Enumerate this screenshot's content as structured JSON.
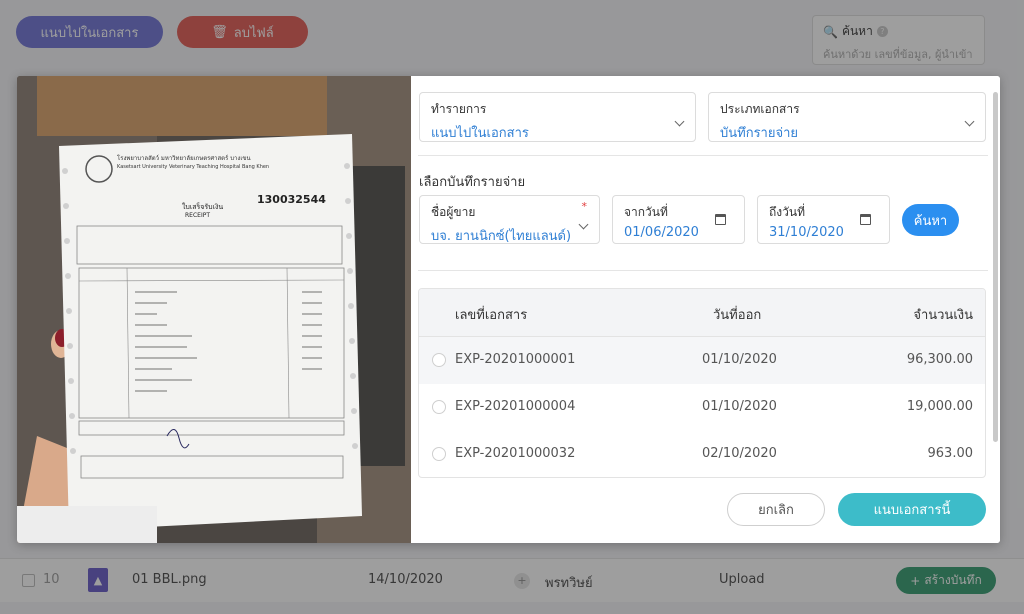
{
  "background": {
    "attach_button": "แนบไปในเอกสาร",
    "delete_button": "ลบไฟล์",
    "search": {
      "label": "ค้นหา",
      "placeholder": "ค้นหาด้วย เลขที่ข้อมูล, ผู้นำเข้า"
    },
    "row": {
      "number": "10",
      "file_name": "01 BBL.png",
      "date": "14/10/2020",
      "user": "พรทวิษย์",
      "status": "Upload",
      "create_button": "สร้างบันทึก"
    }
  },
  "modal": {
    "action_field": {
      "label": "ทำรายการ",
      "value": "แนบไปในเอกสาร"
    },
    "doc_type_field": {
      "label": "ประเภทเอกสาร",
      "value": "บันทึกรายจ่าย"
    },
    "section_title": "เลือกบันทึกรายจ่าย",
    "vendor_field": {
      "label": "ชื่อผู้ขาย",
      "value": "บจ. ยานนิกซ์(ไทยแลนด์)",
      "required_mark": "*"
    },
    "from_date_field": {
      "label": "จากวันที่",
      "value": "01/06/2020"
    },
    "to_date_field": {
      "label": "ถึงวันที่",
      "value": "31/10/2020"
    },
    "search_button": "ค้นหา",
    "table": {
      "headers": {
        "doc_no": "เลขที่เอกสาร",
        "issue_date": "วันที่ออก",
        "amount": "จำนวนเงิน"
      },
      "rows": [
        {
          "doc_no": "EXP-20201000001",
          "issue_date": "01/10/2020",
          "amount": "96,300.00"
        },
        {
          "doc_no": "EXP-20201000004",
          "issue_date": "01/10/2020",
          "amount": "19,000.00"
        },
        {
          "doc_no": "EXP-20201000032",
          "issue_date": "02/10/2020",
          "amount": "963.00"
        }
      ]
    },
    "cancel_button": "ยกเลิก",
    "attach_button": "แนบเอกสารนี้"
  },
  "receipt": {
    "hospital_name_th": "โรงพยาบาลสัตว์ มหาวิทยาลัยเกษตรศาสตร์ บางเขน",
    "hospital_name_en": "Kasetsart University Veterinary Teaching Hospital Bang Khen",
    "title_th": "ใบเสร็จรับเงิน",
    "title_en": "RECEIPT",
    "receipt_no": "130032544"
  },
  "colors": {
    "accent_blue": "#2b8ff0",
    "link_blue": "#2f7fd4",
    "attach_teal": "#3dbcc9",
    "bg_attach": "#6c70d6",
    "bg_delete": "#e2564f",
    "bg_create": "#2f9a6c"
  }
}
